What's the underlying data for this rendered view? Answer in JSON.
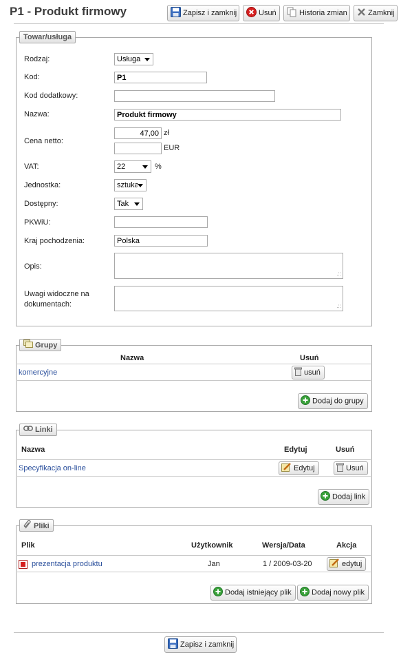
{
  "page": {
    "title": "P1 - Produkt firmowy"
  },
  "toolbar": {
    "save_close": "Zapisz i zamknij",
    "delete": "Usuń",
    "history": "Historia zmian",
    "close": "Zamknij"
  },
  "product_section": {
    "legend": "Towar/usługa",
    "rodzaj": {
      "label": "Rodzaj:",
      "value": "Usługa"
    },
    "kod": {
      "label": "Kod:",
      "value": "P1"
    },
    "kod_dodatkowy": {
      "label": "Kod dodatkowy:",
      "value": ""
    },
    "nazwa": {
      "label": "Nazwa:",
      "value": "Produkt firmowy"
    },
    "cena_netto": {
      "label": "Cena netto:",
      "value_pln": "47,00",
      "unit_pln": "zł",
      "value_eur": "",
      "unit_eur": "EUR"
    },
    "vat": {
      "label": "VAT:",
      "value": "22",
      "unit": "%"
    },
    "jednostka": {
      "label": "Jednostka:",
      "value": "sztuka"
    },
    "dostepny": {
      "label": "Dostępny:",
      "value": "Tak"
    },
    "pkwiu": {
      "label": "PKWiU:",
      "value": ""
    },
    "kraj": {
      "label": "Kraj pochodzenia:",
      "value": "Polska"
    },
    "opis": {
      "label": "Opis:",
      "value": ""
    },
    "uwagi": {
      "label_line1": "Uwagi widoczne na",
      "label_line2": "dokumentach:",
      "value": ""
    }
  },
  "groups_section": {
    "legend": "Grupy",
    "col_name": "Nazwa",
    "col_delete": "Usuń",
    "rows": [
      {
        "name": "komercyjne",
        "delete_label": "usuń"
      }
    ],
    "add_button": "Dodaj do grupy"
  },
  "links_section": {
    "legend": "Linki",
    "col_name": "Nazwa",
    "col_edit": "Edytuj",
    "col_delete": "Usuń",
    "rows": [
      {
        "name": "Specyfikacja on-line",
        "edit_label": "Edytuj",
        "delete_label": "Usuń"
      }
    ],
    "add_button": "Dodaj link"
  },
  "files_section": {
    "legend": "Pliki",
    "col_file": "Plik",
    "col_user": "Użytkownik",
    "col_version": "Wersja/Data",
    "col_action": "Akcja",
    "rows": [
      {
        "file": "prezentacja produktu",
        "user": "Jan",
        "version": "1 / 2009-03-20",
        "action_label": "edytuj"
      }
    ],
    "add_existing_button": "Dodaj istniejący plik",
    "add_new_button": "Dodaj nowy plik"
  },
  "footer": {
    "save_close": "Zapisz i zamknij"
  },
  "icons": {
    "save": "floppy-disk-icon",
    "delete": "red-x-circle-icon",
    "history": "document-copy-icon",
    "close": "gray-x-icon",
    "groups": "folders-icon",
    "links": "chain-link-icon",
    "files": "paperclip-icon",
    "trash": "trash-can-icon",
    "edit": "pencil-note-icon",
    "add": "green-plus-circle-icon",
    "pdf": "pdf-file-icon"
  },
  "colors": {
    "link": "#2a4f9c",
    "title": "#3c3c3c",
    "border": "#a9a9a9",
    "add_green": "#3aa23a",
    "delete_red": "#d62020"
  }
}
